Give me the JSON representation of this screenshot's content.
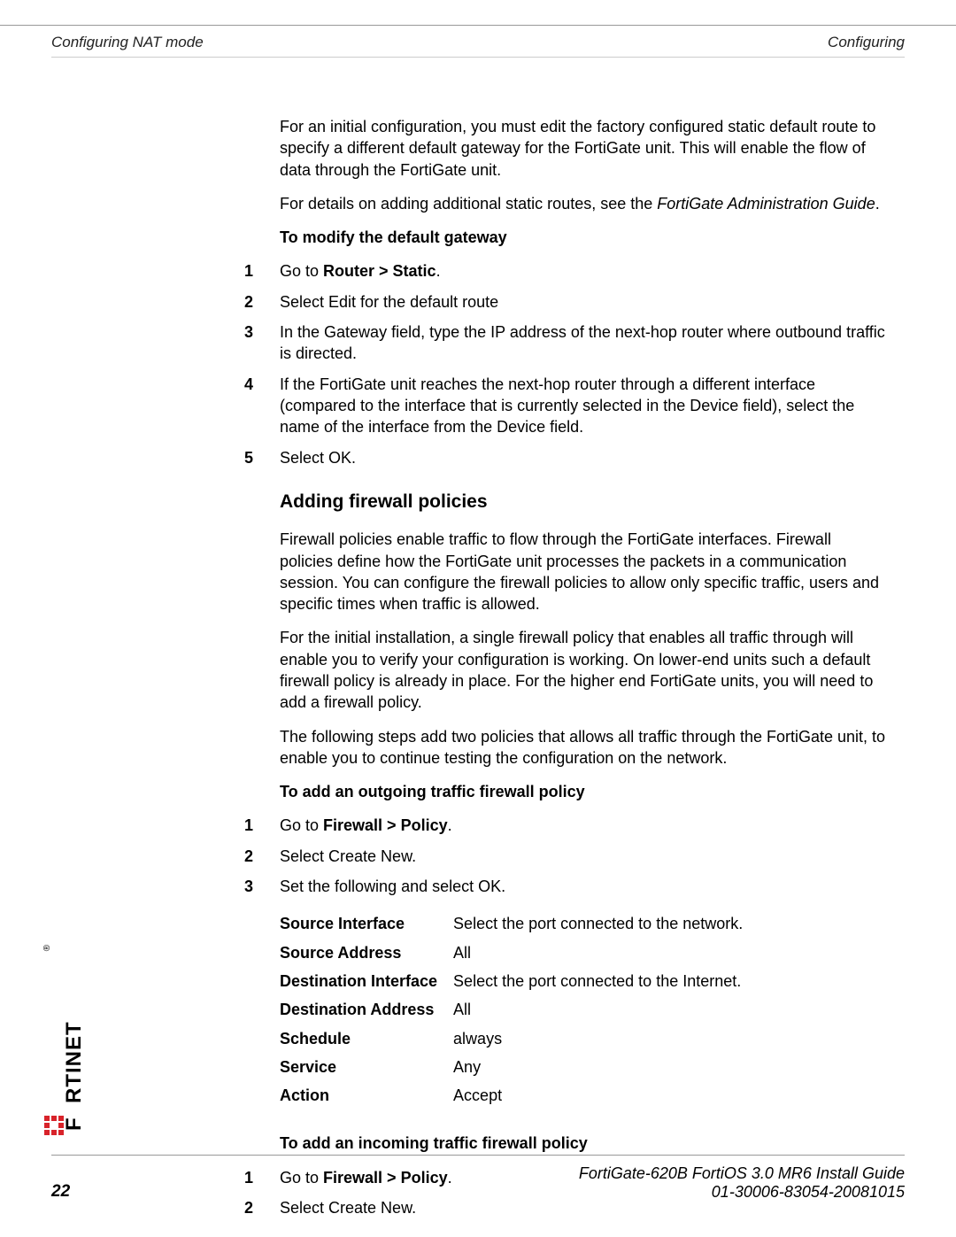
{
  "header": {
    "left": "Configuring NAT mode",
    "right": "Configuring"
  },
  "intro": {
    "p1": "For an initial configuration, you must edit the factory configured static default route to specify a different default gateway for the FortiGate unit. This will enable the flow of data through the FortiGate unit.",
    "p2a": "For details on adding additional static routes, see the ",
    "p2b": "FortiGate Administration Guide",
    "p2c": "."
  },
  "modify": {
    "heading": "To modify the default gateway",
    "steps": [
      {
        "n": "1",
        "pre": "Go to ",
        "bold": "Router > Static",
        "post": "."
      },
      {
        "n": "2",
        "text": "Select Edit for the default route"
      },
      {
        "n": "3",
        "text": "In the Gateway field, type the IP address of the next-hop router where outbound traffic is directed."
      },
      {
        "n": "4",
        "text": "If the FortiGate unit reaches the next-hop router through a different interface (compared to the interface that is currently selected in the Device field), select the name of the interface from the Device field."
      },
      {
        "n": "5",
        "text": "Select OK."
      }
    ]
  },
  "firewall": {
    "heading": "Adding firewall policies",
    "p1": "Firewall policies enable traffic to flow through the FortiGate interfaces. Firewall policies define how the FortiGate unit processes the packets in a communication session. You can configure the firewall policies to allow only specific traffic, users and specific times when traffic is allowed.",
    "p2": "For the initial installation, a single firewall policy that enables all traffic through will enable you to verify your configuration is working. On lower-end units such a default firewall policy is already in place. For the higher end FortiGate units, you will need to add a firewall policy.",
    "p3": "The following steps add two policies that allows all traffic through the FortiGate unit, to enable you to continue testing the configuration on the network."
  },
  "outgoing": {
    "heading": "To add an outgoing traffic firewall policy",
    "steps": [
      {
        "n": "1",
        "pre": "Go to ",
        "bold": "Firewall > Policy",
        "post": "."
      },
      {
        "n": "2",
        "text": "Select Create New."
      },
      {
        "n": "3",
        "text": "Set the following and select OK."
      }
    ],
    "table": [
      {
        "k": "Source Interface",
        "v": "Select the port connected to the network."
      },
      {
        "k": "Source Address",
        "v": "All"
      },
      {
        "k": "Destination Interface",
        "v": "Select the port connected to the Internet."
      },
      {
        "k": "Destination Address",
        "v": "All"
      },
      {
        "k": "Schedule",
        "v": "always"
      },
      {
        "k": "Service",
        "v": "Any"
      },
      {
        "k": "Action",
        "v": "Accept"
      }
    ]
  },
  "incoming": {
    "heading": "To add an incoming traffic firewall policy",
    "steps": [
      {
        "n": "1",
        "pre": "Go to ",
        "bold": "Firewall > Policy",
        "post": "."
      },
      {
        "n": "2",
        "text": "Select Create New."
      }
    ]
  },
  "footer": {
    "page": "22",
    "line1": "FortiGate-620B FortiOS 3.0 MR6 Install Guide",
    "line2": "01-30006-83054-20081015"
  },
  "logo": {
    "text": "F  RTINET",
    "reg": "®"
  }
}
